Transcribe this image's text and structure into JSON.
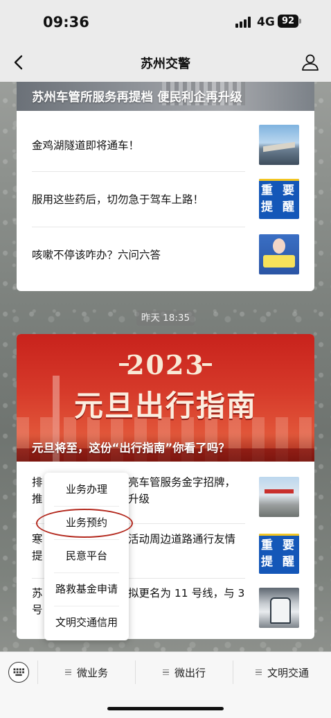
{
  "status_bar": {
    "time": "09:36",
    "network": "4G",
    "battery": "92"
  },
  "nav": {
    "title": "苏州交警"
  },
  "top_card": {
    "banner_title": "苏州车管所服务再提档 便民利企再升级",
    "articles": [
      {
        "title": "金鸡湖隧道即将通车！",
        "thumb_icon": "tunnel-photo"
      },
      {
        "title": "服用这些药后，切勿急于驾车上路！",
        "thumb_text": "重 要\n提 醒",
        "thumb_icon": "alert-poster"
      },
      {
        "title": "咳嗽不停该咋办？六问六答",
        "thumb_icon": "cough-illustration"
      }
    ]
  },
  "timestamp": "昨天 18:35",
  "bottom_card": {
    "hero_year": "2023",
    "hero_headline": "元旦出行指南",
    "hero_caption": "元旦将至，这份“出行指南”你看了吗？",
    "articles": [
      {
        "left_fragment": "排\n推",
        "right_fragment": "亮车管服务金字招牌，\n升级",
        "thumb_icon": "traffic-photo"
      },
      {
        "left_fragment": "寒\n提",
        "right_fragment": "活动周边道路通行友情",
        "thumb_text": "重 要\n提 醒",
        "thumb_icon": "alert-poster"
      },
      {
        "left_fragment": "苏\n号",
        "right_fragment": "拟更名为 11 号线，与 3",
        "thumb_icon": "metro-photo"
      }
    ]
  },
  "popup_menu": {
    "items": [
      "业务办理",
      "业务预约",
      "民意平台",
      "路救基金申请",
      "文明交通信用"
    ],
    "highlighted": "业务预约"
  },
  "bottom_menu": {
    "items": [
      "微业务",
      "微出行",
      "文明交通"
    ]
  },
  "colors": {
    "accent_red": "#c8221c",
    "ring_red": "#b3281d",
    "alert_blue": "#1457b8"
  }
}
